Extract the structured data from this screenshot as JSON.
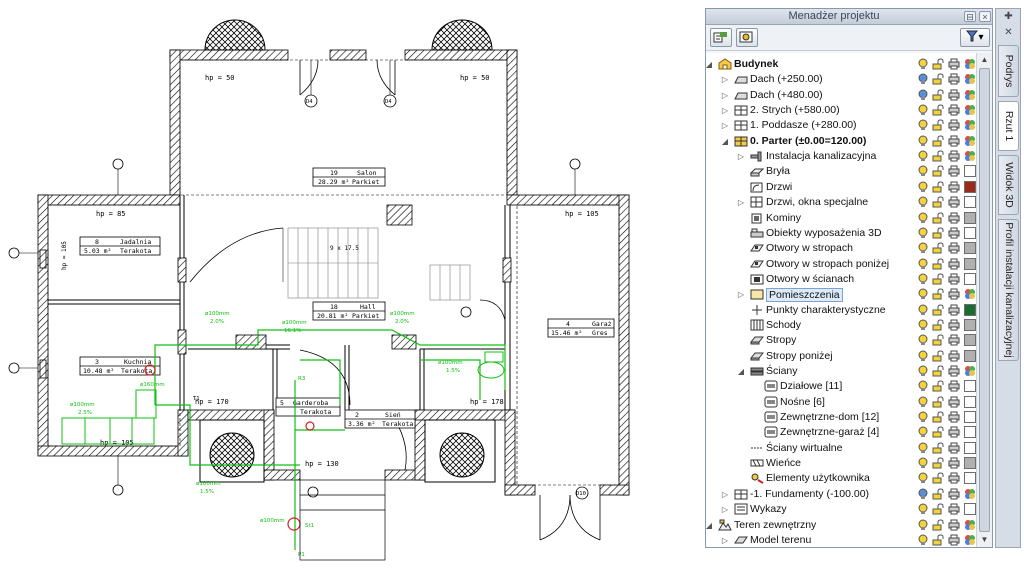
{
  "panel": {
    "title": "Menadżer projektu",
    "pin": "⊟",
    "close": "×",
    "toolbar_filter_arrow": "▾"
  },
  "sidetabs": [
    "Podrys",
    "Rzut 1",
    "Widok 3D",
    "Profil instalacji kanalizacyjnej"
  ],
  "tree": [
    {
      "label": "Budynek",
      "level": 0,
      "expander": "◢",
      "bold": true,
      "icon": "building-icon",
      "lamp": "yellow",
      "swatch": "multi"
    },
    {
      "label": "Dach (+250.00)",
      "level": 1,
      "expander": "▷",
      "icon": "roof-icon",
      "lamp": "blue",
      "swatch": "multi"
    },
    {
      "label": "Dach (+480.00)",
      "level": 1,
      "expander": "▷",
      "icon": "roof-icon",
      "lamp": "blue",
      "swatch": "multi"
    },
    {
      "label": "2. Strych (+580.00)",
      "level": 1,
      "expander": "▷",
      "icon": "floor-icon",
      "lamp": "yellow",
      "swatch": "multi"
    },
    {
      "label": "1. Poddasze (+280.00)",
      "level": 1,
      "expander": "▷",
      "icon": "floor-icon",
      "lamp": "yellow",
      "swatch": "multi"
    },
    {
      "label": "0. Parter (±0.00=120.00)",
      "level": 1,
      "expander": "◢",
      "bold": true,
      "icon": "active-floor-icon",
      "lamp": "yellow",
      "swatch": "multi"
    },
    {
      "label": "Instalacja kanalizacyjna",
      "level": 2,
      "expander": "▷",
      "icon": "pipe-icon",
      "lamp": "yellow",
      "swatch": "multi"
    },
    {
      "label": "Bryła",
      "level": 2,
      "icon": "solid-icon",
      "lamp": "yellow",
      "swatch": "#ffffff"
    },
    {
      "label": "Drzwi",
      "level": 2,
      "icon": "door-icon",
      "lamp": "yellow",
      "swatch": "#9b2a1a"
    },
    {
      "label": "Drzwi, okna specjalne",
      "level": 2,
      "expander": "▷",
      "icon": "window-icon",
      "lamp": "yellow",
      "swatch": "#ffffff"
    },
    {
      "label": "Kominy",
      "level": 2,
      "icon": "chimney-icon",
      "lamp": "yellow",
      "swatch": "#b0b0b0"
    },
    {
      "label": "Obiekty wyposażenia 3D",
      "level": 2,
      "icon": "furniture-icon",
      "lamp": "yellow",
      "swatch": "#ffffff"
    },
    {
      "label": "Otwory w stropach",
      "level": 2,
      "icon": "opening-icon",
      "lamp": "yellow",
      "swatch": "#b0b0b0"
    },
    {
      "label": "Otwory w stropach poniżej",
      "level": 2,
      "icon": "opening-icon",
      "lamp": "yellow",
      "swatch": "#b0b0b0"
    },
    {
      "label": "Otwory w ścianach",
      "level": 2,
      "icon": "wall-opening-icon",
      "lamp": "yellow",
      "swatch": "#ffffff"
    },
    {
      "label": "Pomieszczenia",
      "level": 2,
      "expander": "▷",
      "icon": "room-icon",
      "lamp": "yellow",
      "swatch": "multi",
      "selected": true
    },
    {
      "label": "Punkty charakterystyczne",
      "level": 2,
      "icon": "point-icon",
      "lamp": "yellow",
      "swatch": "#1a6d2f"
    },
    {
      "label": "Schody",
      "level": 2,
      "icon": "stairs-icon",
      "lamp": "yellow",
      "swatch": "#b0b0b0"
    },
    {
      "label": "Stropy",
      "level": 2,
      "icon": "slab-icon",
      "lamp": "yellow",
      "swatch": "#b0b0b0"
    },
    {
      "label": "Stropy poniżej",
      "level": 2,
      "icon": "slab-icon",
      "lamp": "yellow",
      "swatch": "#b0b0b0"
    },
    {
      "label": "Ściany",
      "level": 2,
      "expander": "◢",
      "icon": "wall-icon",
      "lamp": "yellow",
      "swatch": "multi"
    },
    {
      "label": "Działowe [11]",
      "level": 3,
      "icon": "wall-type-icon",
      "lamp": "yellow",
      "swatch": "#ffffff"
    },
    {
      "label": "Nośne [6]",
      "level": 3,
      "icon": "wall-type-icon",
      "lamp": "yellow",
      "swatch": "#ffffff"
    },
    {
      "label": "Zewnętrzne-dom [12]",
      "level": 3,
      "icon": "wall-type-icon",
      "lamp": "yellow",
      "swatch": "#ffffff"
    },
    {
      "label": "Zewnętrzne-garaż [4]",
      "level": 3,
      "icon": "wall-type-icon",
      "lamp": "yellow",
      "swatch": "#ffffff"
    },
    {
      "label": "Ściany wirtualne",
      "level": 2,
      "icon": "virtual-wall-icon",
      "lamp": "yellow",
      "swatch": "#ffffff"
    },
    {
      "label": "Wieńce",
      "level": 2,
      "icon": "ring-beam-icon",
      "lamp": "yellow",
      "swatch": "#b0b0b0"
    },
    {
      "label": "Elementy użytkownika",
      "level": 2,
      "icon": "user-elements-icon",
      "lamp": "yellow",
      "swatch": "#ffffff"
    },
    {
      "label": "-1. Fundamenty (-100.00)",
      "level": 1,
      "expander": "▷",
      "icon": "floor-icon",
      "lamp": "blue",
      "swatch": "multi"
    },
    {
      "label": "Wykazy",
      "level": 1,
      "expander": "▷",
      "icon": "list-icon",
      "lamp": "yellow",
      "swatch": "#ffffff"
    },
    {
      "label": "Teren zewnętrzny",
      "level": 0,
      "expander": "◢",
      "icon": "terrain-icon",
      "lamp": "yellow",
      "swatch": "multi"
    },
    {
      "label": "Model terenu",
      "level": 1,
      "expander": "▷",
      "icon": "terrain-model-icon",
      "lamp": "yellow",
      "swatch": "multi"
    }
  ],
  "plan": {
    "rooms": [
      {
        "num": "19",
        "name": "Salon",
        "area": "28.29 m²",
        "floor": "Parkiet"
      },
      {
        "num": "8",
        "name": "Jadalnia",
        "area": "5.03 m²",
        "floor": "Terakota"
      },
      {
        "num": "18",
        "name": "Hall",
        "area": "20.81 m²",
        "floor": "Parkiet"
      },
      {
        "num": "4",
        "name": "Garaż",
        "area": "15.46 m²",
        "floor": "Gres"
      },
      {
        "num": "3",
        "name": "Kuchnia",
        "area": "10.48 m²",
        "floor": "Terakota"
      },
      {
        "num": "2",
        "name": "Sień",
        "area": "3.36 m²",
        "floor": "Terakota"
      },
      {
        "num": "5",
        "name": "Garderoba",
        "area": "",
        "floor": "Terakota"
      }
    ],
    "labels": {
      "hp50a": "hp = 50",
      "hp50b": "hp = 50",
      "hp85": "hp = 85",
      "hp105a": "hp = 105",
      "hp105b": "hp = 105",
      "hp105c": "hp = 105",
      "hp170": "hp = 170",
      "hp178": "hp = 178",
      "hp130": "hp = 130",
      "d4a": "D4",
      "d4b": "D4",
      "d10": "D10",
      "p1": "P1",
      "st1": "St1",
      "r3": "R3",
      "t1": "T1",
      "stairs": "9 x 17.5",
      "p100a": "ø100mm",
      "p100b": "ø100mm",
      "p100c": "ø100mm",
      "p100d": "ø100mm",
      "p100e": "ø100mm",
      "p100f": "ø100mm",
      "p100g": "ø100mm",
      "p160": "ø160mm",
      "pct1": "2.0%",
      "pct2": "16.1%",
      "pct3": "2.0%",
      "pct4": "1.5%",
      "pct5": "2.5%",
      "pct6": "1.5%"
    }
  }
}
